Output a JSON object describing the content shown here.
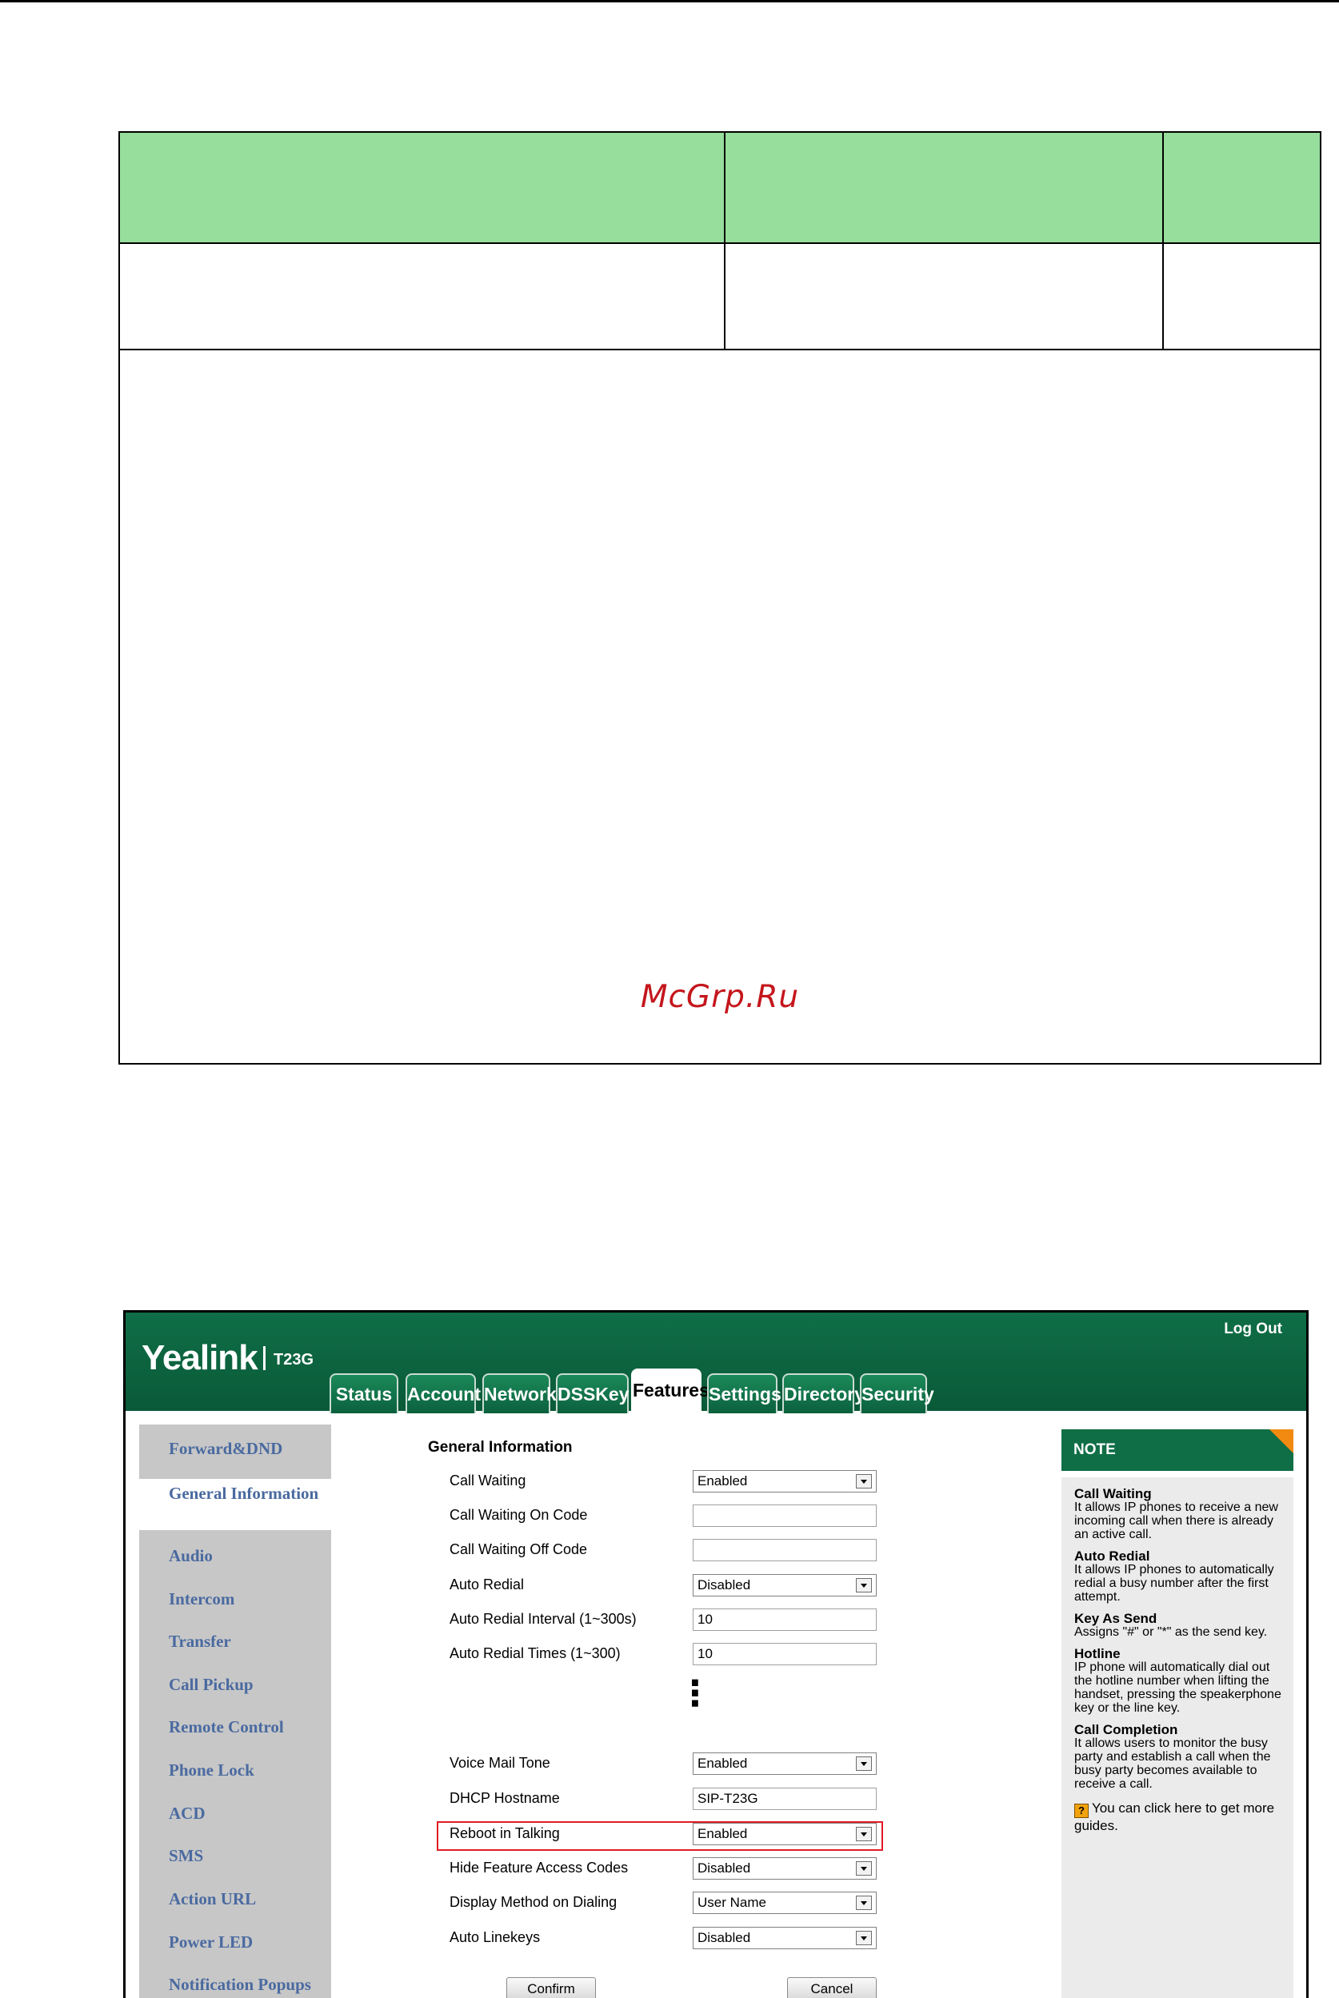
{
  "watermark": "McGrp.Ru",
  "header": {
    "brand": "Yealink",
    "model": "T23G",
    "logout": "Log Out"
  },
  "tabs": [
    "Status",
    "Account",
    "Network",
    "DSSKey",
    "Features",
    "Settings",
    "Directory",
    "Security"
  ],
  "active_tab": "Features",
  "sidebar": {
    "items": [
      "Forward&DND",
      "General Information",
      "Audio",
      "Intercom",
      "Transfer",
      "Call Pickup",
      "Remote Control",
      "Phone Lock",
      "ACD",
      "SMS",
      "Action URL",
      "Power LED",
      "Notification Popups"
    ],
    "active": "General Information"
  },
  "main": {
    "section_title": "General Information",
    "fields": [
      {
        "label": "Call Waiting",
        "type": "select",
        "value": "Enabled"
      },
      {
        "label": "Call Waiting On Code",
        "type": "input",
        "value": ""
      },
      {
        "label": "Call Waiting Off Code",
        "type": "input",
        "value": ""
      },
      {
        "label": "Auto Redial",
        "type": "select",
        "value": "Disabled"
      },
      {
        "label": "Auto Redial Interval (1~300s)",
        "type": "input",
        "value": "10"
      },
      {
        "label": "Auto Redial Times (1~300)",
        "type": "input",
        "value": "10"
      },
      {
        "label": "Voice Mail Tone",
        "type": "select",
        "value": "Enabled"
      },
      {
        "label": "DHCP Hostname",
        "type": "input",
        "value": "SIP-T23G"
      },
      {
        "label": "Reboot in Talking",
        "type": "select",
        "value": "Enabled"
      },
      {
        "label": "Hide Feature Access Codes",
        "type": "select",
        "value": "Disabled"
      },
      {
        "label": "Display Method on Dialing",
        "type": "select",
        "value": "User Name"
      },
      {
        "label": "Auto Linekeys",
        "type": "select",
        "value": "Disabled"
      }
    ],
    "ellipsis": "⋮",
    "confirm_label": "Confirm",
    "cancel_label": "Cancel"
  },
  "note": {
    "title": "NOTE",
    "items": [
      {
        "title": "Call Waiting",
        "text": "It allows IP phones to receive a new incoming call when there is already an active call."
      },
      {
        "title": "Auto Redial",
        "text": "It allows IP phones to automatically redial a busy number after the first attempt."
      },
      {
        "title": "Key As Send",
        "text": "Assigns \"#\" or \"*\" as the send key."
      },
      {
        "title": "Hotline",
        "text": "IP phone will automatically dial out the hotline number when lifting the handset, pressing the speakerphone key or the line key."
      },
      {
        "title": "Call Completion",
        "text": "It allows users to monitor the busy party and establish a call when the busy party becomes available to receive a call."
      }
    ],
    "hint": "You can click here to get more guides."
  },
  "colors": {
    "header_green": "#0f6e46",
    "table_header": "#97dd9c",
    "highlight": "#e01b24",
    "link_blue": "#4a6aa0",
    "note_corner": "#f28a12"
  }
}
